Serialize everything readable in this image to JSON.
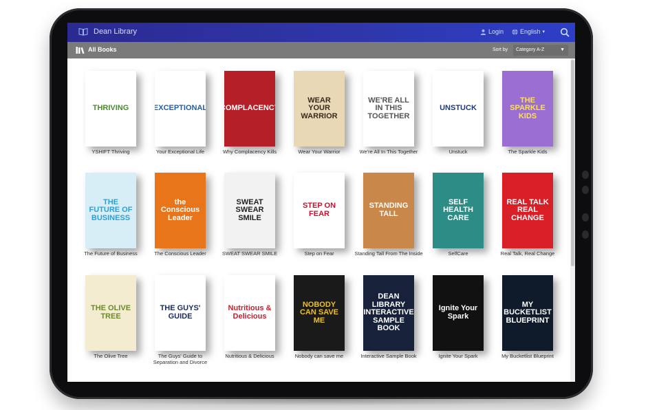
{
  "app": {
    "brand": "Dean Library"
  },
  "header": {
    "login_label": "Login",
    "language_label": "English",
    "search_icon": "search-icon"
  },
  "toolbar": {
    "section_label": "All Books",
    "sort_label": "Sort by",
    "sort_value": "Category A-Z"
  },
  "books": [
    {
      "title": "YSHIFT Thriving",
      "cover_text": "THRIVING",
      "bg": "#ffffff",
      "fg": "#4a8c2a"
    },
    {
      "title": "Your Exceptional Life",
      "cover_text": "EXCEPTIONAL",
      "bg": "#ffffff",
      "fg": "#1e5fa8"
    },
    {
      "title": "Why Complacency Kills",
      "cover_text": "COMPLACENCY",
      "bg": "#b51f27",
      "fg": "#ffffff"
    },
    {
      "title": "Wear Your Warrior",
      "cover_text": "WEAR YOUR WARRIOR",
      "bg": "#e9d8b6",
      "fg": "#3a2a1a"
    },
    {
      "title": "We're All In This Together",
      "cover_text": "WE'RE ALL IN THIS TOGETHER",
      "bg": "#ffffff",
      "fg": "#555555"
    },
    {
      "title": "Unstuck",
      "cover_text": "UNSTUCK",
      "bg": "#ffffff",
      "fg": "#1a3a7a"
    },
    {
      "title": "The Sparkle Kids",
      "cover_text": "THE SPARKLE KIDS",
      "bg": "#9b6fd1",
      "fg": "#ffe14a"
    },
    {
      "title": "The Future of Business",
      "cover_text": "THE FUTURE OF BUSINESS",
      "bg": "#d8eef7",
      "fg": "#2aa0d8"
    },
    {
      "title": "The Conscious Leader",
      "cover_text": "the Conscious Leader",
      "bg": "#e8751a",
      "fg": "#ffffff"
    },
    {
      "title": "SWEAT SWEAR SMILE",
      "cover_text": "SWEAT SWEAR SMILE",
      "bg": "#f2f2f2",
      "fg": "#222222"
    },
    {
      "title": "Step on Fear",
      "cover_text": "STEP ON FEAR",
      "bg": "#ffffff",
      "fg": "#c8102e"
    },
    {
      "title": "Standing Tall From The Inside",
      "cover_text": "STANDING TALL",
      "bg": "#c9874a",
      "fg": "#ffffff"
    },
    {
      "title": "SelfCare",
      "cover_text": "SELF HEALTH CARE",
      "bg": "#2d8c86",
      "fg": "#ffffff"
    },
    {
      "title": "Real Talk, Real Change",
      "cover_text": "REAL TALK REAL CHANGE",
      "bg": "#d81f26",
      "fg": "#ffffff"
    },
    {
      "title": "The Olive Tree",
      "cover_text": "THE OLIVE TREE",
      "bg": "#f4ecd0",
      "fg": "#6a8a2a"
    },
    {
      "title": "The Guys' Guide to Separation and Divorce",
      "cover_text": "THE GUYS' GUIDE",
      "bg": "#ffffff",
      "fg": "#1a2a5a"
    },
    {
      "title": "Nutritious & Delicious",
      "cover_text": "Nutritious & Delicious",
      "bg": "#ffffff",
      "fg": "#c8202e"
    },
    {
      "title": "Nobody can save me",
      "cover_text": "NOBODY CAN SAVE ME",
      "bg": "#1a1a1a",
      "fg": "#f0c020"
    },
    {
      "title": "Interactive Sample Book",
      "cover_text": "DEAN LIBRARY INTERACTIVE SAMPLE BOOK",
      "bg": "#17213a",
      "fg": "#ffffff"
    },
    {
      "title": "Ignite Your Spark",
      "cover_text": "Ignite Your Spark",
      "bg": "#111111",
      "fg": "#ffffff"
    },
    {
      "title": "My Bucketlist Blueprint",
      "cover_text": "MY BUCKETLIST BLUEPRINT",
      "bg": "#0f1a2a",
      "fg": "#ffffff"
    }
  ]
}
